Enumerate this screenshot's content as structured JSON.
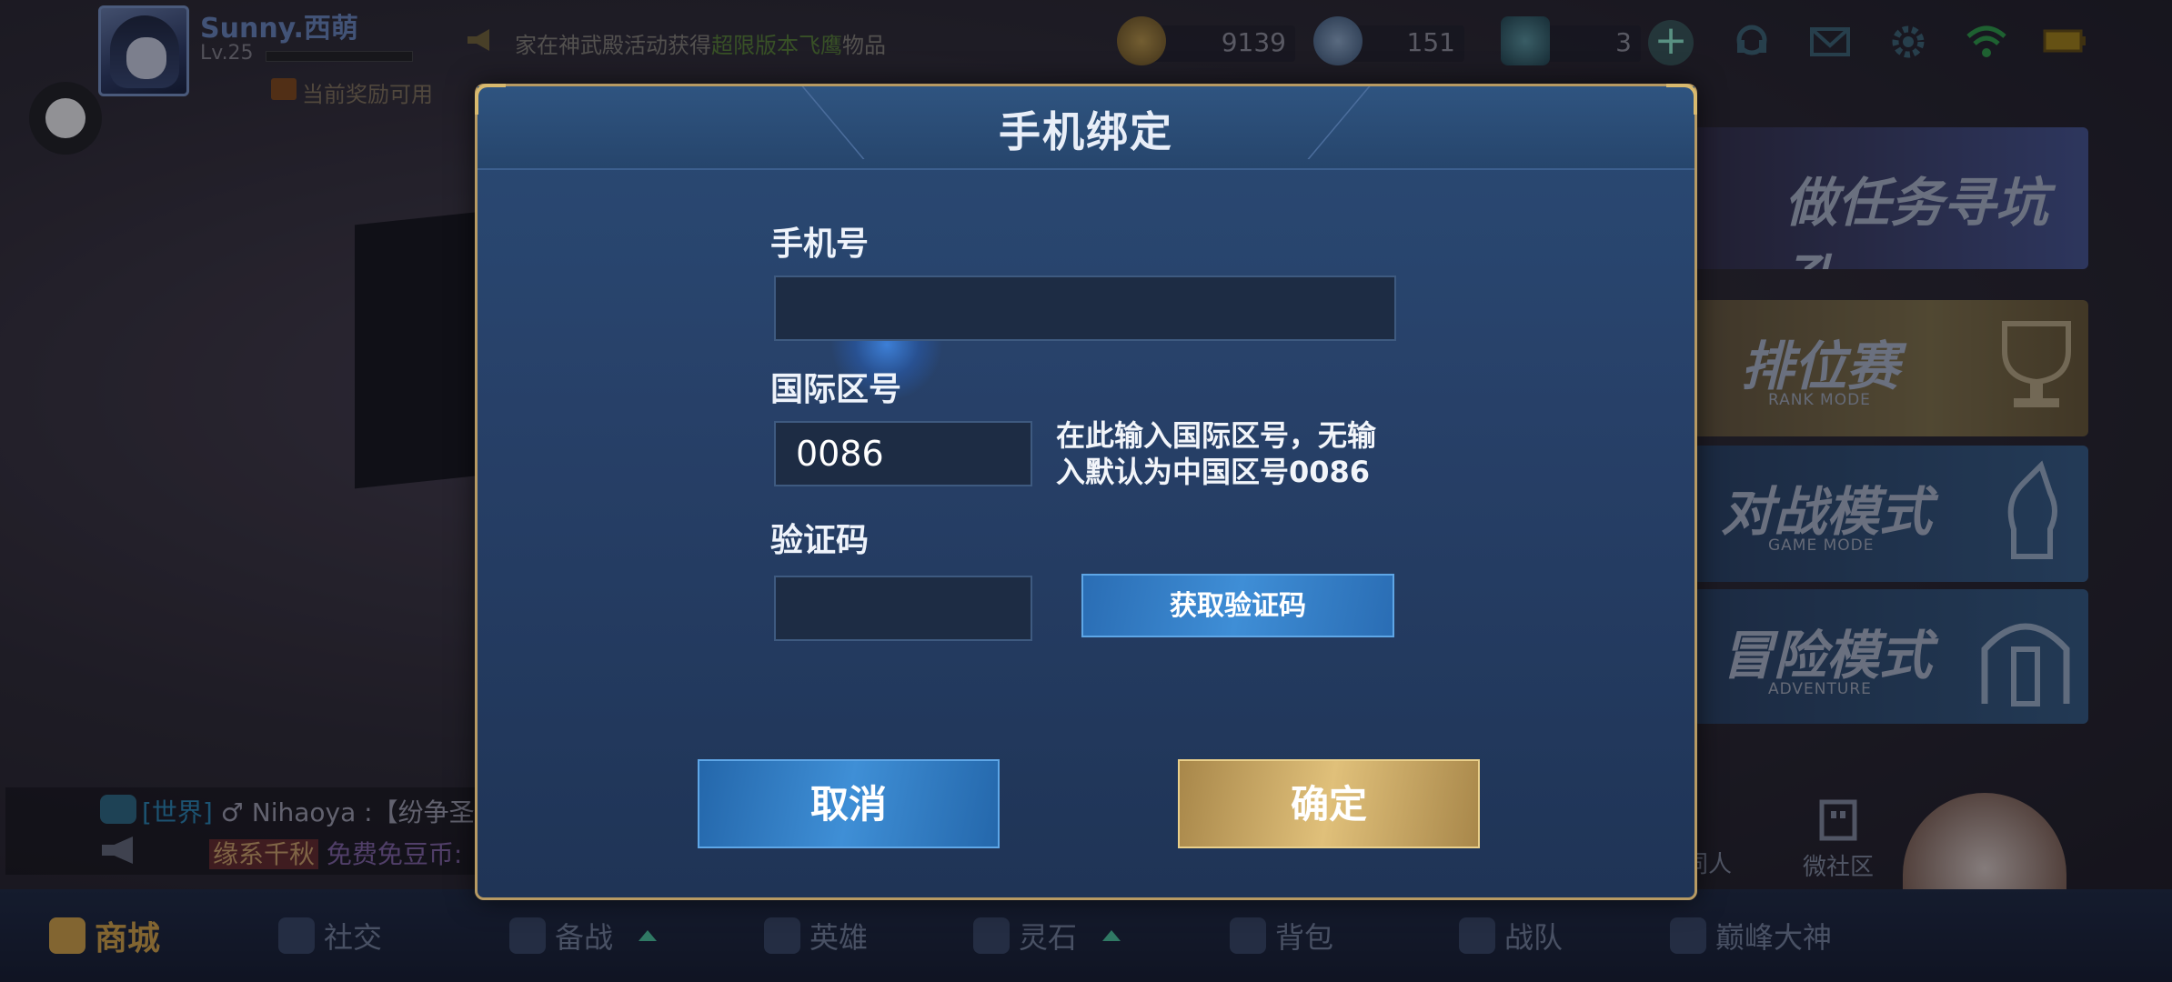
{
  "player": {
    "name": "Sunny.西萌",
    "level": "Lv.25",
    "exp_fraction": 0.0,
    "reward_tag": "当前奖励可用"
  },
  "notice": {
    "prefix": "家在神武殿活动获得",
    "highlight": "超限版本飞鹰",
    "suffix": "物品"
  },
  "resources": {
    "gold": "9139",
    "diamond": "151",
    "token": "3"
  },
  "banners": {
    "quest": {
      "title": "做任务寻坑孔"
    },
    "rank": {
      "title": "排位赛",
      "subtitle": "RANK MODE"
    },
    "battle": {
      "title": "对战模式",
      "subtitle": "GAME MODE"
    },
    "adventure": {
      "title": "冒险模式",
      "subtitle": "ADVENTURE"
    }
  },
  "chat": {
    "line1_channel": "[世界]",
    "line1_text": "♂ Nihaoya :【纷争圣坛",
    "line2_tag": "缘系千秋",
    "line2_text": "免费免豆币:"
  },
  "side_buttons": {
    "colleague": "同人",
    "community": "微社区"
  },
  "bottom_nav": [
    {
      "label": "商城"
    },
    {
      "label": "社交"
    },
    {
      "label": "备战"
    },
    {
      "label": "英雄"
    },
    {
      "label": "灵石"
    },
    {
      "label": "背包"
    },
    {
      "label": "战队"
    },
    {
      "label": "巅峰大神"
    }
  ],
  "modal": {
    "title": "手机绑定",
    "phone_label": "手机号",
    "phone_value": "",
    "region_label": "国际区号",
    "region_value": "0086",
    "region_hint": "在此输入国际区号，无输入默认为中国区号0086",
    "code_label": "验证码",
    "code_value": "",
    "get_code_button": "获取验证码",
    "cancel_button": "取消",
    "confirm_button": "确定"
  },
  "colors": {
    "modal_bg": "#274068",
    "modal_border": "#b79a63",
    "blue_button": "#3f8ed6",
    "gold_button": "#e0c07a"
  }
}
